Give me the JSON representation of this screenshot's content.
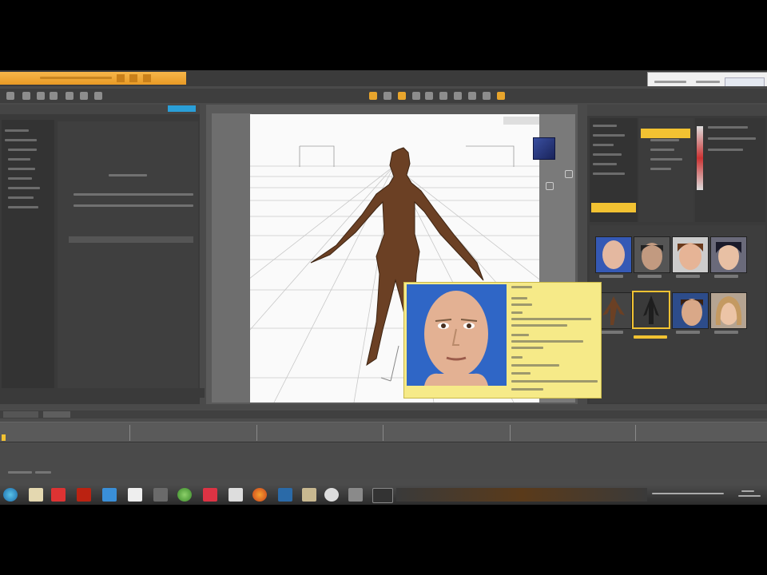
{
  "window": {
    "title_partial": "",
    "accent_color": "#f2c232",
    "highlight_color": "#2a9fd8"
  },
  "toolbar": {
    "icons": [
      "new-icon",
      "open-icon",
      "save-icon",
      "undo-icon",
      "redo-icon",
      "render-icon",
      "light-icon",
      "camera-icon",
      "rotate-icon",
      "translate-icon",
      "scale-icon",
      "node-icon",
      "universal-icon",
      "figure-icon",
      "joint-icon",
      "surface-icon",
      "window-icon"
    ]
  },
  "viewport": {
    "figure": "humanoid-figure",
    "cube": "view-cube"
  },
  "popup": {
    "title": "",
    "colors": {
      "bg": "#f6ea88",
      "img": "#2f66c6"
    }
  },
  "timeline": {
    "ticks": 6
  },
  "taskbar": {
    "icons": [
      "start-icon",
      "explorer-icon",
      "app-icon",
      "media-icon",
      "store-icon",
      "word-icon",
      "folder-icon",
      "chrome-icon",
      "pdf-icon",
      "k-icon",
      "firefox-icon",
      "task-icon",
      "folder2-icon",
      "settings-icon",
      "window-icon",
      "monitor-icon"
    ]
  },
  "content_library": {
    "thumbnails": [
      "face-bald",
      "face-dark",
      "face-young",
      "face-cartoon",
      "figure-creature",
      "figure-selected",
      "face-male",
      "face-female"
    ]
  }
}
